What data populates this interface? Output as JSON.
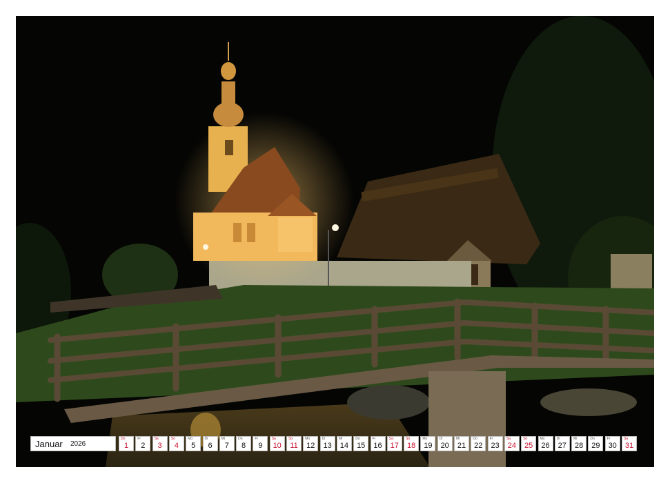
{
  "calendar": {
    "month": "Januar",
    "year": "2026",
    "days": [
      {
        "wd": "Do",
        "num": "1",
        "red": true
      },
      {
        "wd": "Fr",
        "num": "2",
        "red": false
      },
      {
        "wd": "Sa",
        "num": "3",
        "red": true
      },
      {
        "wd": "So",
        "num": "4",
        "red": true
      },
      {
        "wd": "Mo",
        "num": "5",
        "red": false
      },
      {
        "wd": "Di",
        "num": "6",
        "red": false
      },
      {
        "wd": "Mi",
        "num": "7",
        "red": false
      },
      {
        "wd": "Do",
        "num": "8",
        "red": false
      },
      {
        "wd": "Fr",
        "num": "9",
        "red": false
      },
      {
        "wd": "Sa",
        "num": "10",
        "red": true
      },
      {
        "wd": "So",
        "num": "11",
        "red": true
      },
      {
        "wd": "Mo",
        "num": "12",
        "red": false
      },
      {
        "wd": "Di",
        "num": "13",
        "red": false
      },
      {
        "wd": "Mi",
        "num": "14",
        "red": false
      },
      {
        "wd": "Do",
        "num": "15",
        "red": false
      },
      {
        "wd": "Fr",
        "num": "16",
        "red": false
      },
      {
        "wd": "Sa",
        "num": "17",
        "red": true
      },
      {
        "wd": "So",
        "num": "18",
        "red": true
      },
      {
        "wd": "Mo",
        "num": "19",
        "red": false
      },
      {
        "wd": "Di",
        "num": "20",
        "red": false
      },
      {
        "wd": "Mi",
        "num": "21",
        "red": false
      },
      {
        "wd": "Do",
        "num": "22",
        "red": false
      },
      {
        "wd": "Fr",
        "num": "23",
        "red": false
      },
      {
        "wd": "Sa",
        "num": "24",
        "red": true
      },
      {
        "wd": "So",
        "num": "25",
        "red": true
      },
      {
        "wd": "Mo",
        "num": "26",
        "red": false
      },
      {
        "wd": "Di",
        "num": "27",
        "red": false
      },
      {
        "wd": "Mi",
        "num": "28",
        "red": false
      },
      {
        "wd": "Do",
        "num": "29",
        "red": false
      },
      {
        "wd": "Fr",
        "num": "30",
        "red": false
      },
      {
        "wd": "Sa",
        "num": "31",
        "red": true
      }
    ]
  },
  "colors": {
    "weekend_red": "#c8102e",
    "church_glow": "#e8a948",
    "night_sky": "#050503"
  }
}
